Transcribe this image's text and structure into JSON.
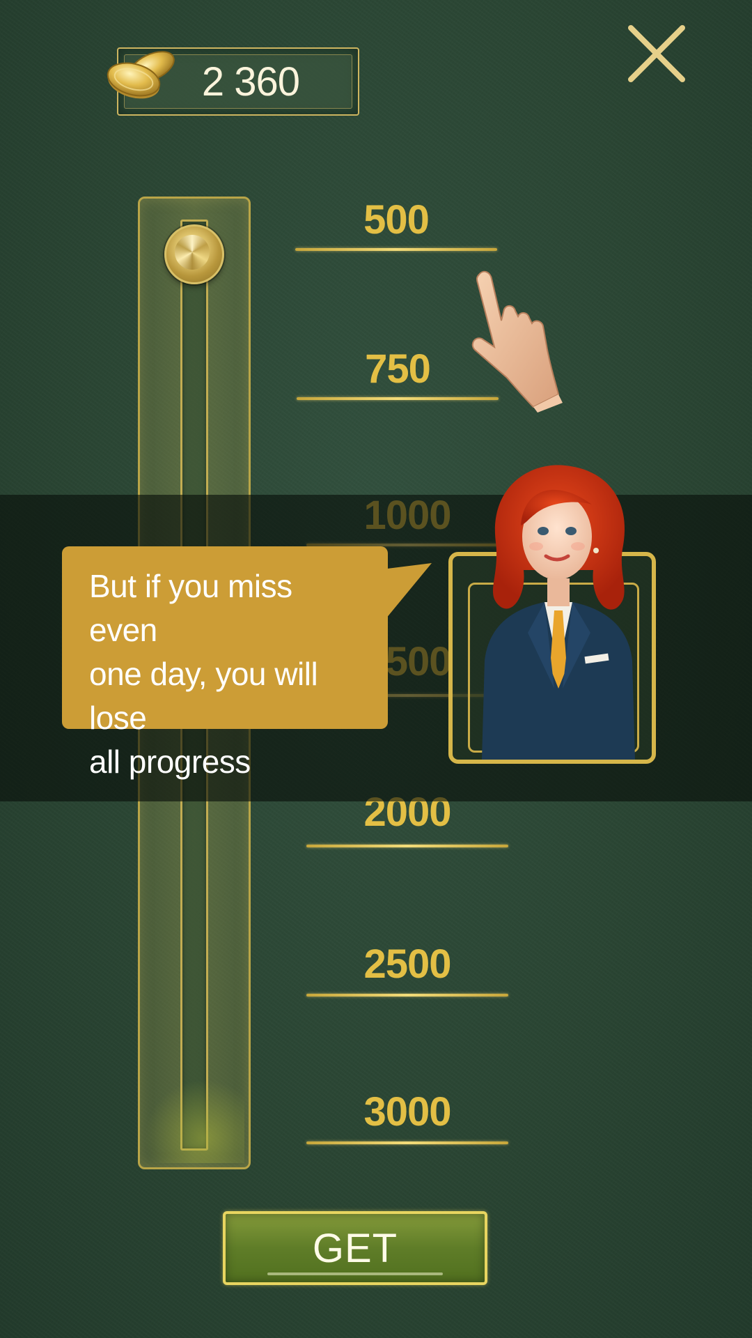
{
  "balance": {
    "coins": "2 360",
    "icon": "coins-icon"
  },
  "close": {
    "icon": "close-icon"
  },
  "slider": {
    "value": 500,
    "min": 500,
    "max": 3000
  },
  "levels": [
    {
      "label": "500"
    },
    {
      "label": "750"
    },
    {
      "label": "1000"
    },
    {
      "label": "1500"
    },
    {
      "label": "2000"
    },
    {
      "label": "2500"
    },
    {
      "label": "3000"
    }
  ],
  "tutorial": {
    "message": "But if you miss even one day, you will lose all progress",
    "message_lines": [
      "But if you miss even",
      "one day, you will lose",
      "all progress"
    ],
    "pointer_icon": "pointing-hand-icon",
    "character": "redhead-host-avatar"
  },
  "actions": {
    "get_label": "GET"
  },
  "colors": {
    "accent_gold": "#cc9d36",
    "felt": "#2a4533",
    "button_green": "#5f7d28"
  }
}
